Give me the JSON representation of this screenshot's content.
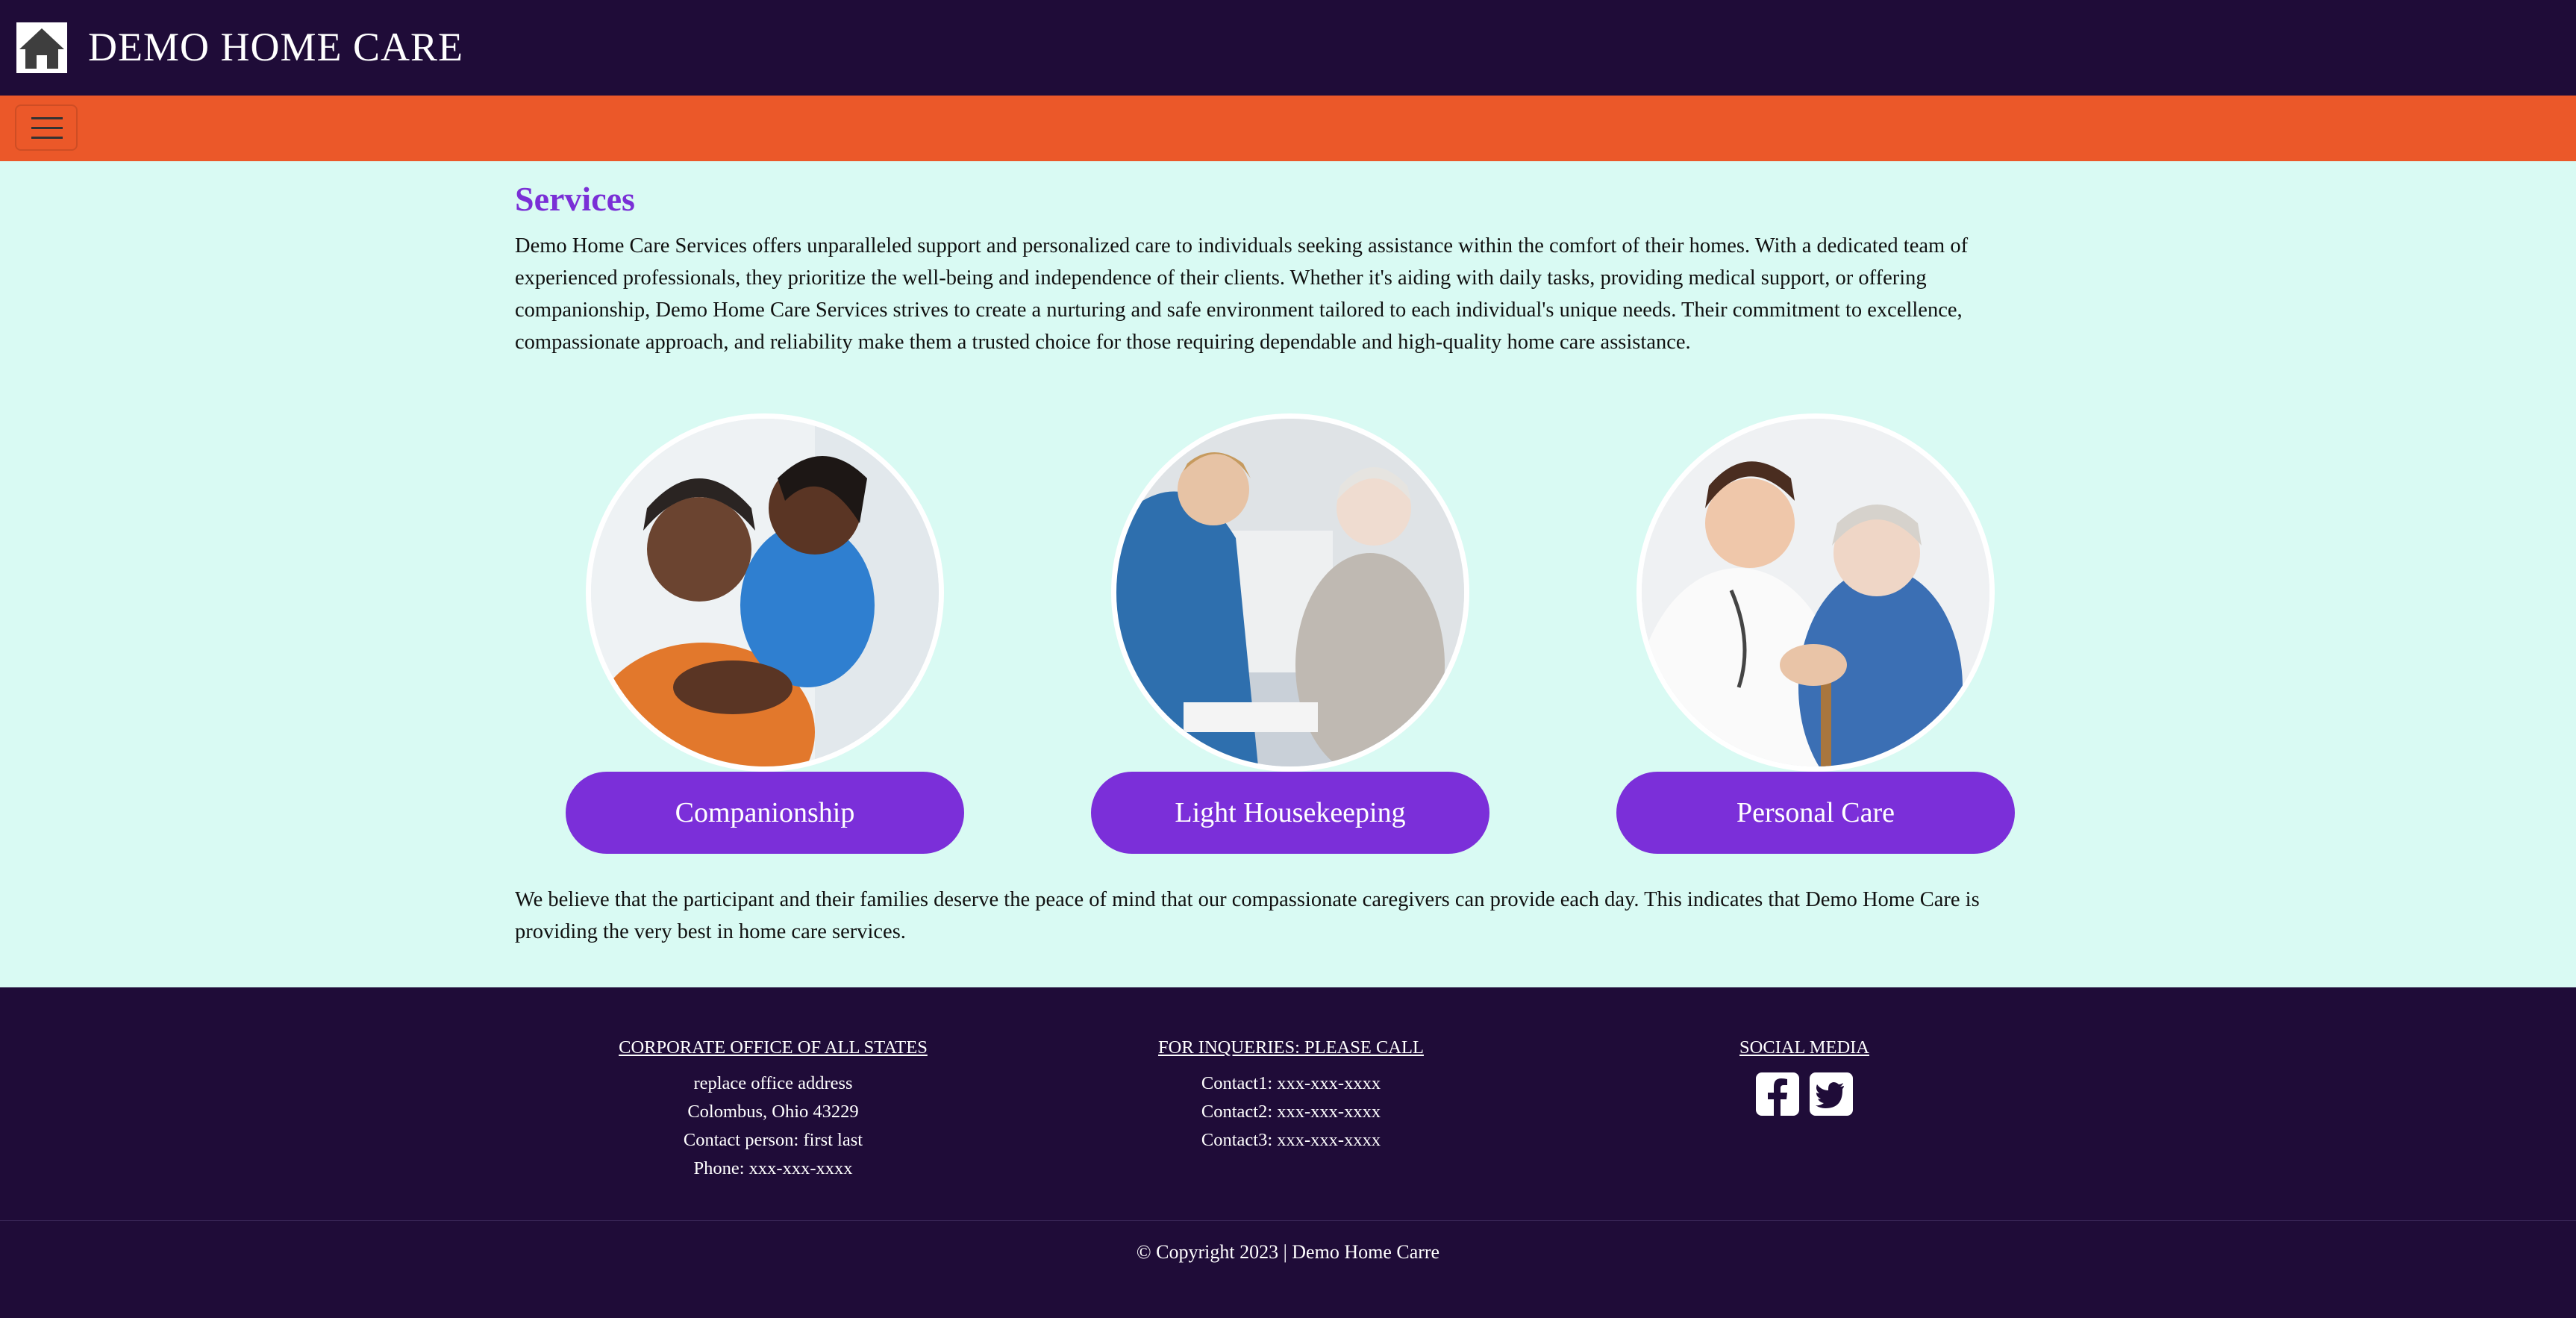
{
  "header": {
    "brand": "DEMO HOME CARE",
    "logo_icon": "house-icon"
  },
  "nav": {
    "toggle_icon": "hamburger-menu-icon"
  },
  "main": {
    "title": "Services",
    "intro": "Demo Home Care Services offers unparalleled support and personalized care to individuals seeking assistance within the comfort of their homes. With a dedicated team of experienced professionals, they prioritize the well-being and independence of their clients. Whether it's aiding with daily tasks, providing medical support, or offering companionship, Demo Home Care Services strives to create a nurturing and safe environment tailored to each individual's unique needs. Their commitment to excellence, compassionate approach, and reliability make them a trusted choice for those requiring dependable and high-quality home care assistance.",
    "services": [
      {
        "label": "Companionship"
      },
      {
        "label": "Light Housekeeping"
      },
      {
        "label": "Personal Care"
      }
    ],
    "belief": "We believe that the participant and their families deserve the peace of mind that our compassionate caregivers can provide each day. This indicates that Demo Home Care is providing the very best in home care services."
  },
  "footer": {
    "office": {
      "heading": "CORPORATE OFFICE OF ALL STATES",
      "lines": [
        "replace office address",
        "Colombus, Ohio 43229",
        "Contact person: first last",
        "Phone: xxx-xxx-xxxx"
      ]
    },
    "inquiries": {
      "heading": "FOR INQUERIES: PLEASE CALL",
      "lines": [
        "Contact1: xxx-xxx-xxxx",
        "Contact2: xxx-xxx-xxxx",
        "Contact3: xxx-xxx-xxxx"
      ]
    },
    "social": {
      "heading": "SOCIAL MEDIA",
      "icons": [
        "facebook-icon",
        "twitter-icon"
      ]
    },
    "copyright": "© Copyright 2023 | Demo Home Carre"
  },
  "colors": {
    "header_bg": "#1f0c38",
    "nav_bg": "#eb5829",
    "page_bg": "#d9faf3",
    "accent": "#7b2fd9"
  }
}
